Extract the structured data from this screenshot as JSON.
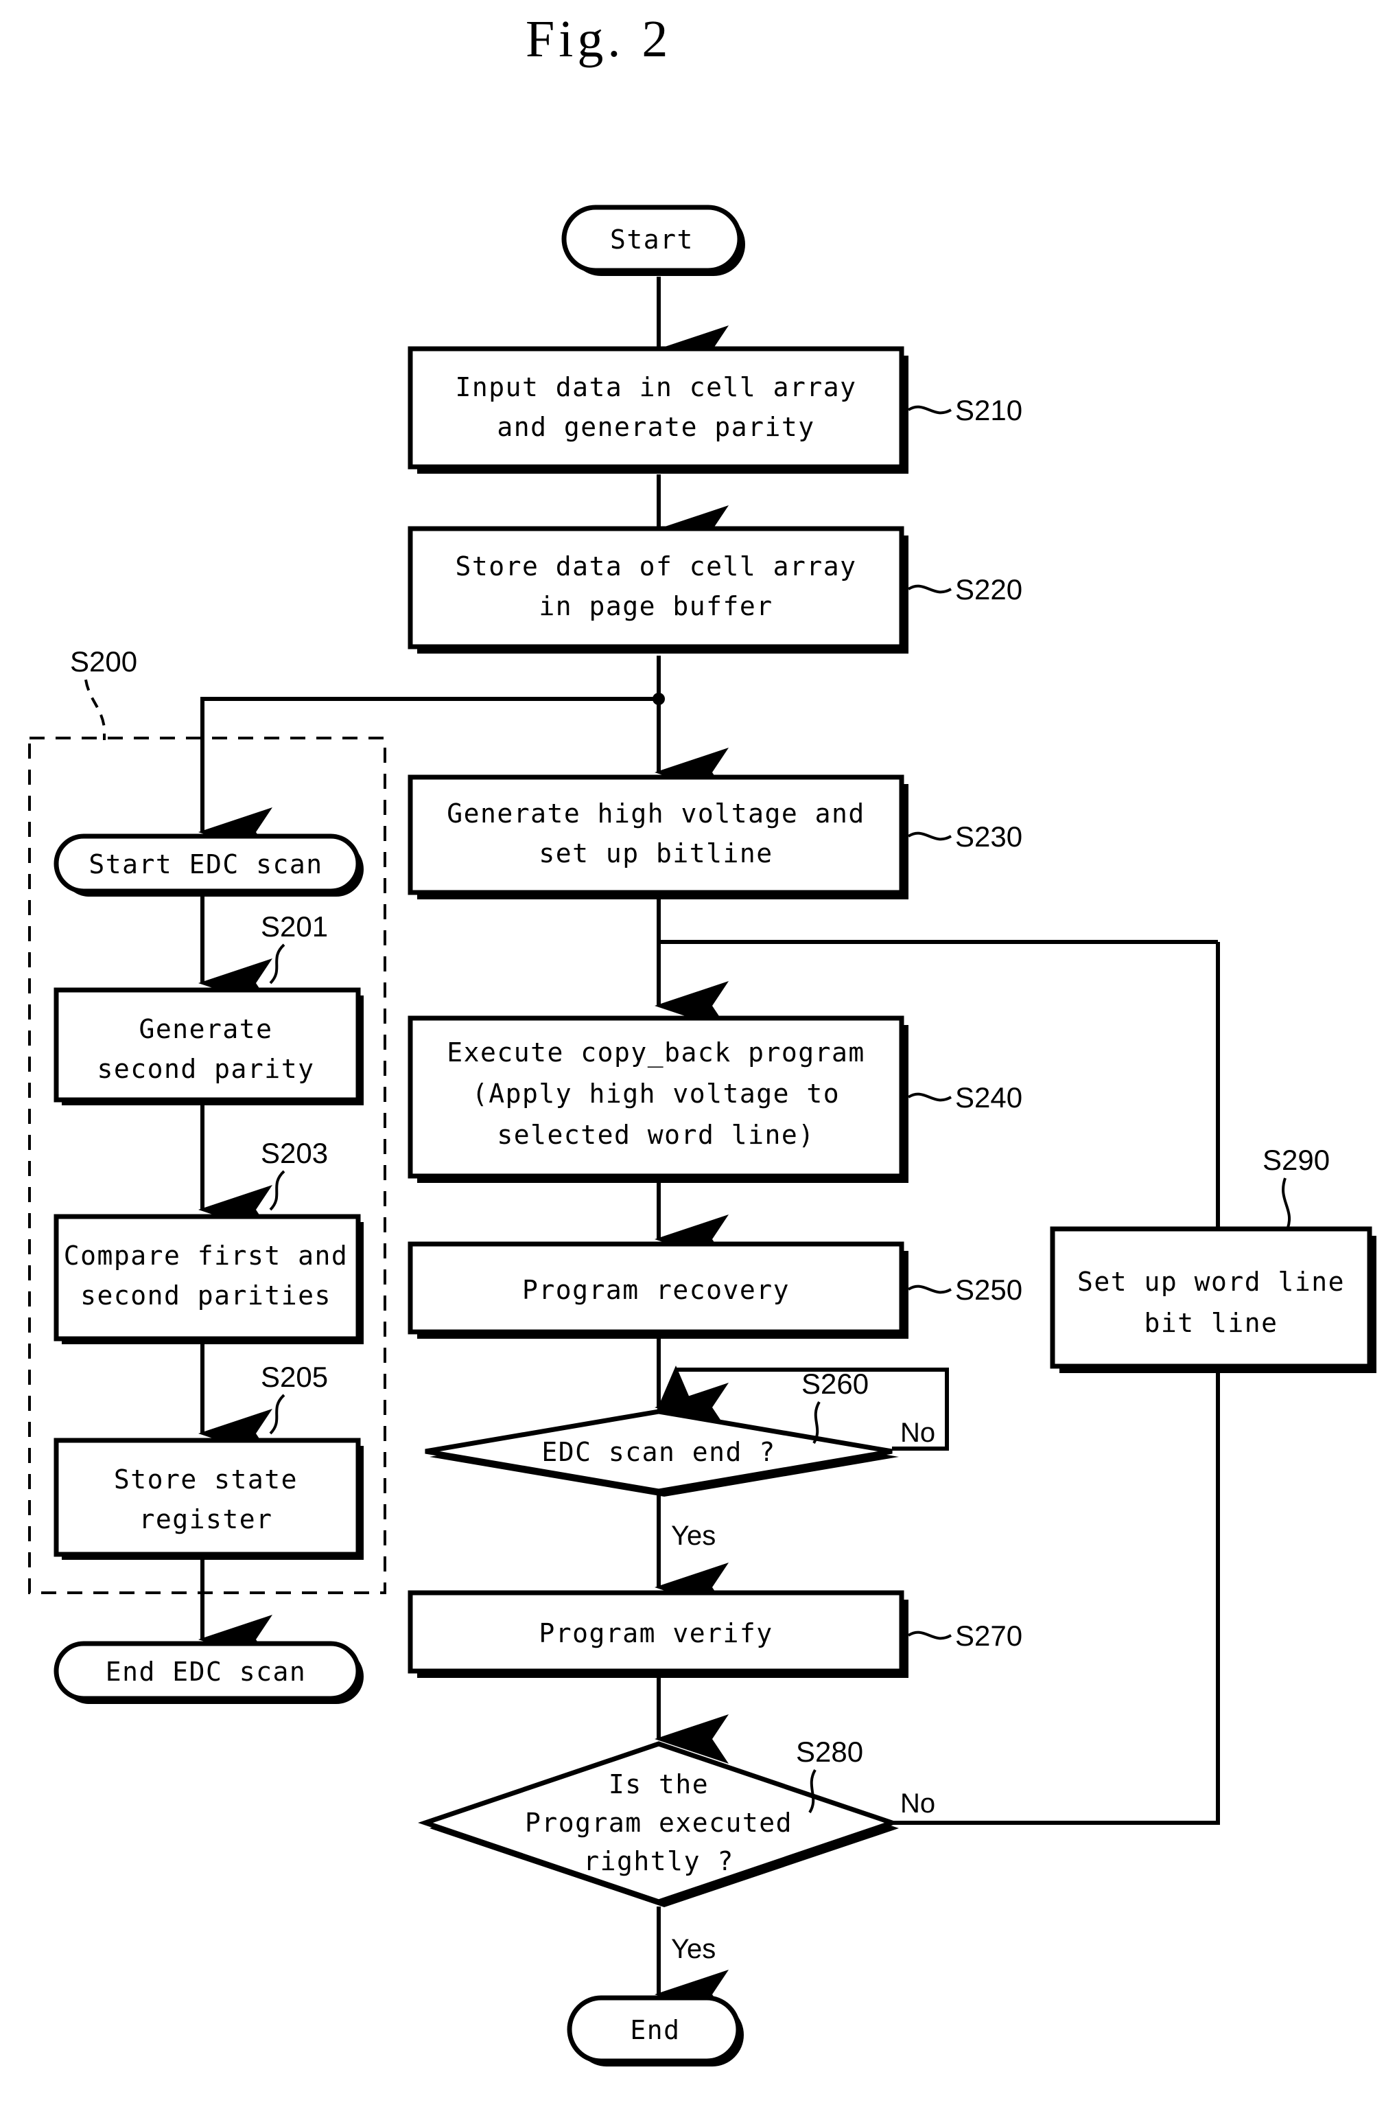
{
  "figure": {
    "title": "Fig. 2",
    "type": "patent-flowchart"
  },
  "nodes": {
    "start": {
      "label": "Start",
      "shape": "terminator"
    },
    "s210": {
      "line1": "Input data in cell array",
      "line2": "and generate parity",
      "ref": "S210",
      "shape": "process"
    },
    "s220": {
      "line1": "Store data of cell array",
      "line2": "in page buffer",
      "ref": "S220",
      "shape": "process"
    },
    "s230": {
      "line1": "Generate high voltage and",
      "line2": "set up bitline",
      "ref": "S230",
      "shape": "process"
    },
    "s240": {
      "line1": "Execute copy_back program",
      "line2": "(Apply high voltage to",
      "line3": "selected word line)",
      "ref": "S240",
      "shape": "process"
    },
    "s250": {
      "line1": "Program recovery",
      "ref": "S250",
      "shape": "process"
    },
    "s260": {
      "line1": "EDC scan end ?",
      "ref": "S260",
      "shape": "decision"
    },
    "s270": {
      "line1": "Program verify",
      "ref": "S270",
      "shape": "process"
    },
    "s280": {
      "line1": "Is the",
      "line2": "Program executed",
      "line3": "rightly ?",
      "ref": "S280",
      "shape": "decision"
    },
    "s290": {
      "line1": "Set up word line",
      "line2": "bit line",
      "ref": "S290",
      "shape": "process"
    },
    "end": {
      "label": "End",
      "shape": "terminator"
    },
    "edc_start": {
      "label": "Start EDC scan",
      "shape": "terminator"
    },
    "s201": {
      "line1": "Generate",
      "line2": "second parity",
      "ref": "S201",
      "shape": "process"
    },
    "s203": {
      "line1": "Compare first and",
      "line2": "second parities",
      "ref": "S203",
      "shape": "process"
    },
    "s205": {
      "line1": "Store state",
      "line2": "register",
      "ref": "S205",
      "shape": "process"
    },
    "edc_end": {
      "label": "End EDC scan",
      "shape": "terminator"
    }
  },
  "groups": {
    "s200": {
      "ref": "S200",
      "description": "EDC scan subprocess region"
    }
  },
  "branch_labels": {
    "s260_no": "No",
    "s260_yes": "Yes",
    "s280_no": "No",
    "s280_yes": "Yes"
  },
  "colors": {
    "stroke": "#000000",
    "fill": "#ffffff",
    "background": "#ffffff"
  }
}
